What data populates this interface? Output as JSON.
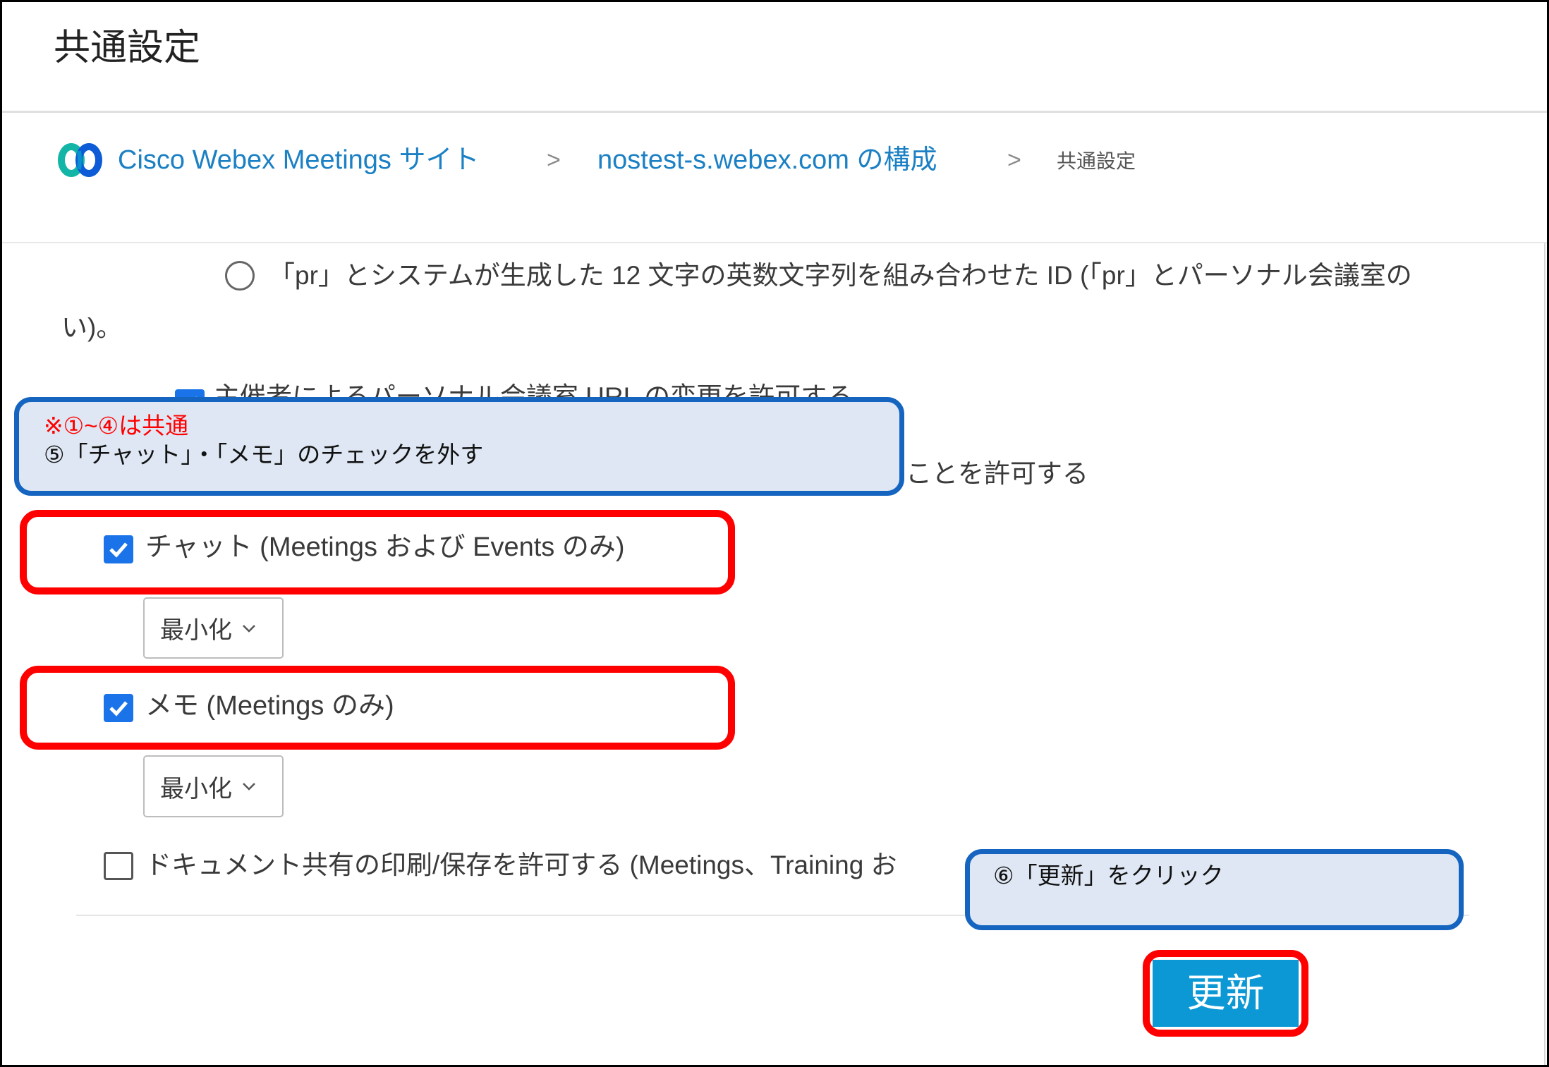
{
  "header": {
    "title": "共通設定"
  },
  "breadcrumb": {
    "separator": ">",
    "items": [
      {
        "label": "Cisco Webex Meetings サイト"
      },
      {
        "label": "nostest-s.webex.com の構成"
      },
      {
        "label": "共通設定"
      }
    ]
  },
  "settings": {
    "pr_radio": {
      "label": "「pr」とシステムが生成した 12 文字の英数文字列を組み合わせた ID (「pr」とパーソナル会議室の",
      "continuation": "い)。",
      "selected": false
    },
    "host_url_change": {
      "label": "主催者によるパーソナル会議室 URL の変更を許可する",
      "checked": true
    },
    "partial_option": {
      "label": "ことを許可する"
    },
    "chat": {
      "label": "チャット (Meetings および Events のみ)",
      "checked": true,
      "select_value": "最小化"
    },
    "notes": {
      "label": "メモ (Meetings のみ)",
      "checked": true,
      "select_value": "最小化"
    },
    "doc_print": {
      "label": "ドキュメント共有の印刷/保存を許可する (Meetings、Training お",
      "checked": false
    }
  },
  "buttons": {
    "update_label": "更新"
  },
  "annotations": {
    "note_common": "※①~④は共通",
    "step5": "⑤「チャット」・「メモ」のチェックを外す",
    "step6": "⑥「更新」をクリック"
  },
  "icons": {
    "logo": "webex-logo",
    "check": "check-icon",
    "dropdown": "chevron-down-icon"
  },
  "colors": {
    "accent": "#1a73e8",
    "link": "#1b80c4",
    "highlight_red": "#ff0000",
    "callout_border": "#1565c0",
    "callout_bg": "#dee7f3",
    "button_bg": "#0c98d5"
  }
}
